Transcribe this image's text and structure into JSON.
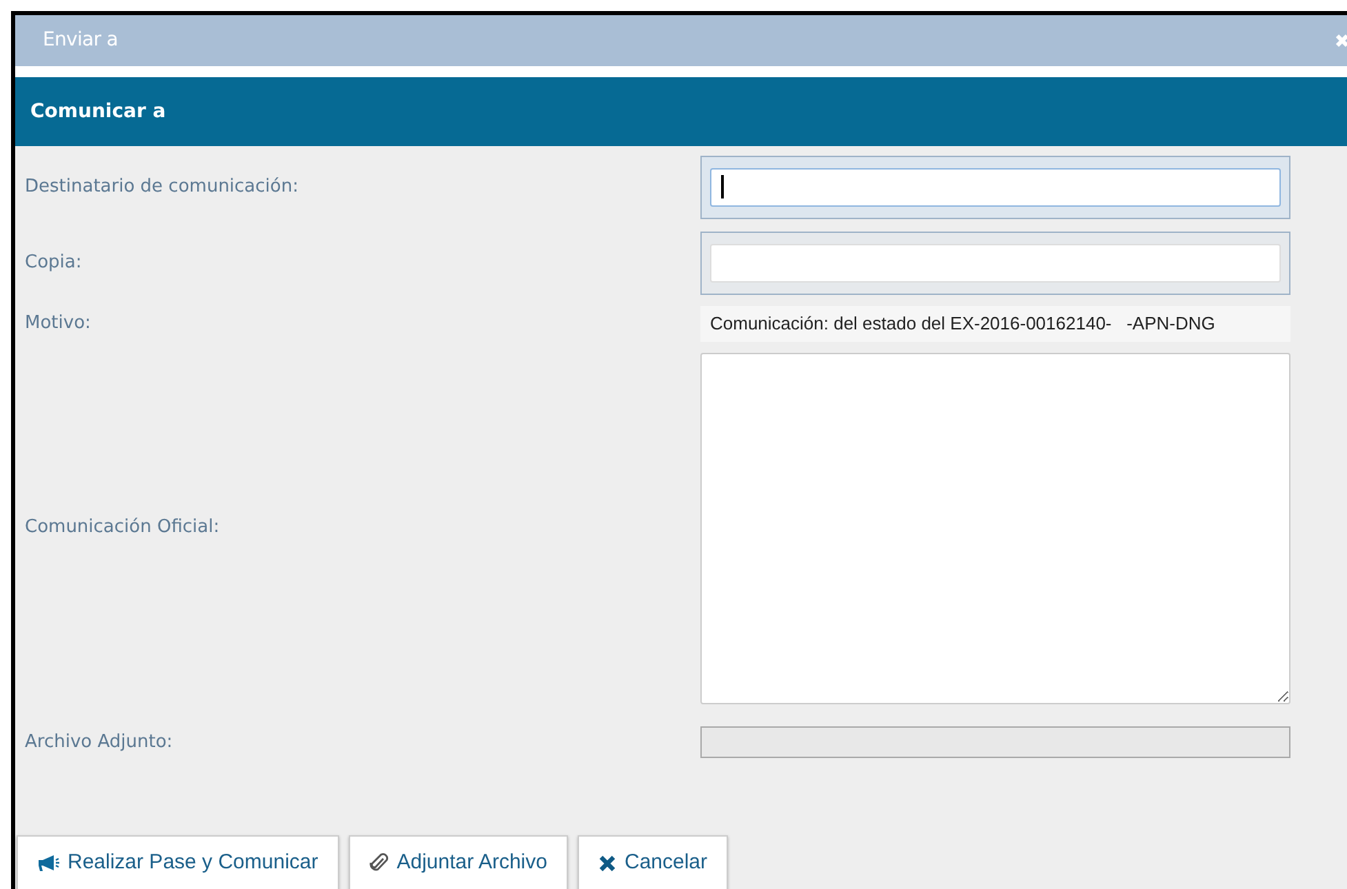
{
  "window": {
    "title": "Enviar a"
  },
  "section": {
    "title": "Comunicar a"
  },
  "fields": [
    {
      "kind": "text",
      "label": "Destinatario de comunicación:",
      "focused": true
    },
    {
      "kind": "text",
      "label": "Copia:",
      "focused": false
    },
    {
      "kind": "readonly",
      "label": "Motivo:",
      "value": "Comunicación: del estado del EX-2016-00162140-   -APN-DNG"
    },
    {
      "kind": "textarea",
      "label": "Comunicación Oficial:"
    },
    {
      "kind": "file",
      "label": "Archivo Adjunto:"
    }
  ],
  "buttons": [
    {
      "kind": "announce",
      "label": "Realizar Pase y Comunicar"
    },
    {
      "kind": "attach",
      "label": "Adjuntar Archivo"
    },
    {
      "kind": "cancel",
      "label": "Cancelar"
    }
  ]
}
